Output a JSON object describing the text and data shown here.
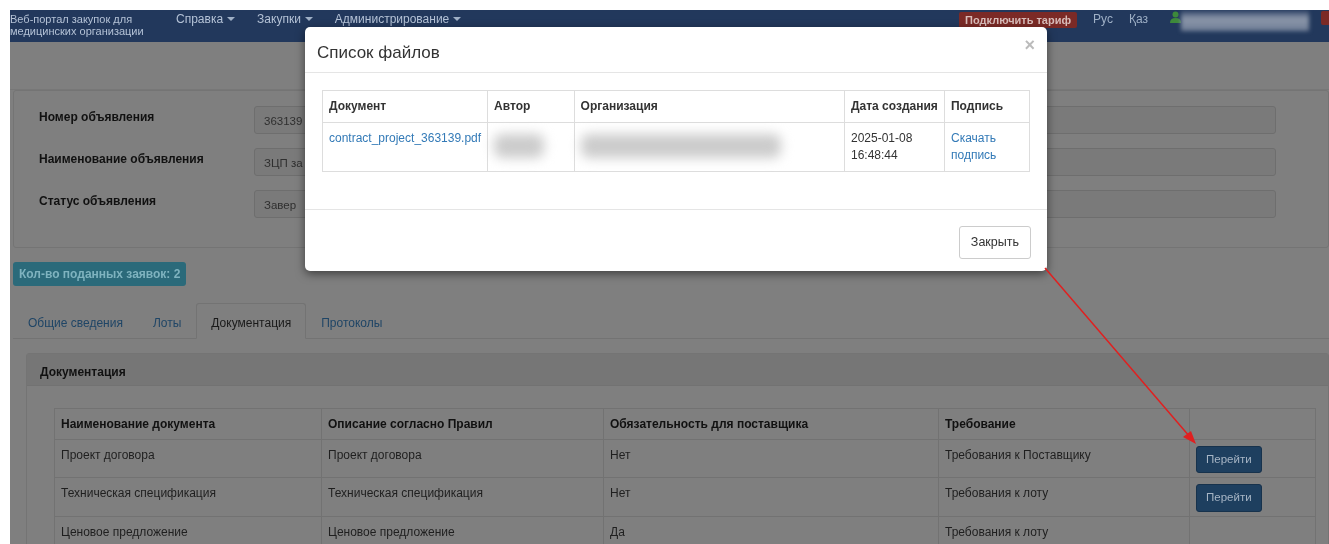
{
  "navbar": {
    "brand": "Веб-портал закупок для медицинских организации",
    "menus": [
      {
        "label": "Справка"
      },
      {
        "label": "Закупки"
      },
      {
        "label": "Администрирование"
      }
    ],
    "tariff_button": "Подключить тариф",
    "languages": [
      {
        "label": "Рус"
      },
      {
        "label": "Қаз"
      }
    ]
  },
  "form": {
    "fields": [
      {
        "label": "Номер объявления",
        "value": "363139"
      },
      {
        "label": "Наименование объявления",
        "value": "ЗЦП за"
      },
      {
        "label": "Статус объявления",
        "value": "Завер"
      }
    ]
  },
  "applications_badge": "Кол-во поданных заявок: 2",
  "tabs": [
    {
      "label": "Общие сведения",
      "selected": false
    },
    {
      "label": "Лоты",
      "selected": false
    },
    {
      "label": "Документация",
      "selected": true
    },
    {
      "label": "Протоколы",
      "selected": false
    }
  ],
  "documentation": {
    "title": "Документация",
    "columns": [
      "Наименование документа",
      "Описание согласно Правил",
      "Обязательность для поставщика",
      "Требование"
    ],
    "rows": [
      {
        "name": "Проект договора",
        "description": "Проект договора",
        "mandatory": "Нет",
        "requirement": "Требования к Поставщику",
        "action": "Перейти"
      },
      {
        "name": "Техническая спецификация",
        "description": "Техническая спецификация",
        "mandatory": "Нет",
        "requirement": "Требования к лоту",
        "action": "Перейти"
      },
      {
        "name": "Ценовое предложение",
        "description": "Ценовое предложение",
        "mandatory": "Да",
        "requirement": "Требования к лоту"
      }
    ]
  },
  "modal": {
    "title": "Список файлов",
    "close": "×",
    "columns": [
      "Документ",
      "Автор",
      "Организация",
      "Дата создания",
      "Подпись"
    ],
    "rows": [
      {
        "document": "contract_project_363139.pdf",
        "created": "2025-01-08 16:48:44",
        "signature": "Скачать подпись"
      }
    ],
    "close_button": "Закрыть"
  }
}
